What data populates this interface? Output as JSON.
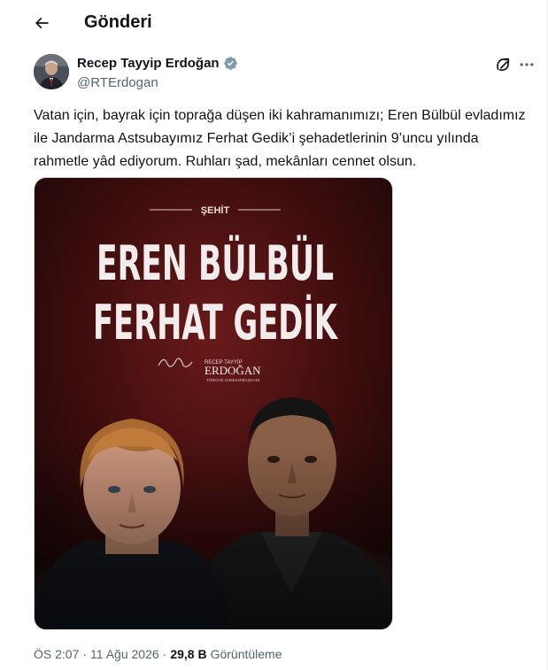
{
  "header": {
    "title": "Gönderi",
    "back_icon": "arrow-left-icon"
  },
  "author": {
    "display_name": "Recep Tayyip Erdoğan",
    "handle": "@RTErdogan",
    "verified_icon": "verified-badge-icon",
    "verified_color": "#829aab"
  },
  "actions": {
    "grok_icon": "grok-icon",
    "more_icon": "more-horizontal-icon"
  },
  "tweet": {
    "text": "Vatan için, bayrak için toprağa düşen iki kahramanımızı; Eren Bülbül evladımız ile Jandarma Astsubayımız Ferhat Gedik’i şehadetlerinin 9’uncu yılında rahmetle yâd ediyorum. Ruhları şad, mekânları cennet olsun."
  },
  "media": {
    "kicker": "ŞEHİT",
    "line1": "EREN BÜLBÜL",
    "line2": "FERHAT GEDİK",
    "signature_small": "RECEP TAYYİP",
    "signature_big": "ERDOĞAN",
    "signature_caption": "TÜRKİYE CUMHURBAŞKANI"
  },
  "meta": {
    "time": "ÖS 2:07",
    "dot": "·",
    "date": "11 Ağu 2026",
    "views_count": "29,8 B",
    "views_label": "Görüntüleme"
  },
  "colors": {
    "text": "#0f1419",
    "secondary": "#536471",
    "poster_dark": "#1a0a0a",
    "poster_red": "#5a1414"
  }
}
